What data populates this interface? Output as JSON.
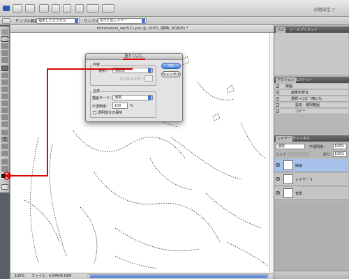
{
  "app": {
    "workspace_label": "初期設定 ▽"
  },
  "options_bar": {
    "sample_label": "サンプル範囲：",
    "sample_value": "指定したピクセル",
    "sample2_label": "サンプル：",
    "sample2_value": "すべてのレイヤー"
  },
  "document": {
    "title": "himatubosi_sen511.pct @ 100% (線画, RGB/8) *",
    "zoom": "100%",
    "file_info": "ファイル : 4.54M/6.05M"
  },
  "dialog": {
    "title": "塗りつぶし",
    "contents_group": "内容",
    "use_label": "使用：",
    "use_value": "描画色",
    "custom_pattern_label": "カスタムパターン：",
    "blending_group": "合成",
    "mode_label": "描画モード：",
    "mode_value": "通常",
    "opacity_label": "不透明度：",
    "opacity_value": "100",
    "opacity_unit": "%",
    "preserve_transparency": "透明部分の保持",
    "ok_label": "OK",
    "cancel_label": "キャンセル"
  },
  "panels": {
    "top_tabs": [
      "パス",
      "ツールプリセット"
    ],
    "actions_tabs": [
      "アクション",
      "ヒストリー"
    ],
    "actions": [
      {
        "label": "線画",
        "checked": true
      },
      {
        "label": "画像を統合",
        "checked": true
      },
      {
        "label": "選択→コピー時にも",
        "checked": true
      },
      {
        "label": "設定 : 選択範囲",
        "checked": true
      },
      {
        "label": "コピー",
        "checked": true
      }
    ],
    "layers_tabs": [
      "レイヤー",
      "チャンネル"
    ],
    "blend_mode": "通常",
    "opacity_label": "不透明度：",
    "opacity_value": "100%",
    "lock_label": "ロック：",
    "fill_label": "塗り：",
    "fill_value": "100%",
    "layers": [
      {
        "name": "線画",
        "active": true
      },
      {
        "name": "レイヤー 1",
        "active": false
      },
      {
        "name": "背景",
        "active": false
      }
    ]
  },
  "colors": {
    "accent": "#3d6fd8",
    "annotation": "#e00000"
  }
}
